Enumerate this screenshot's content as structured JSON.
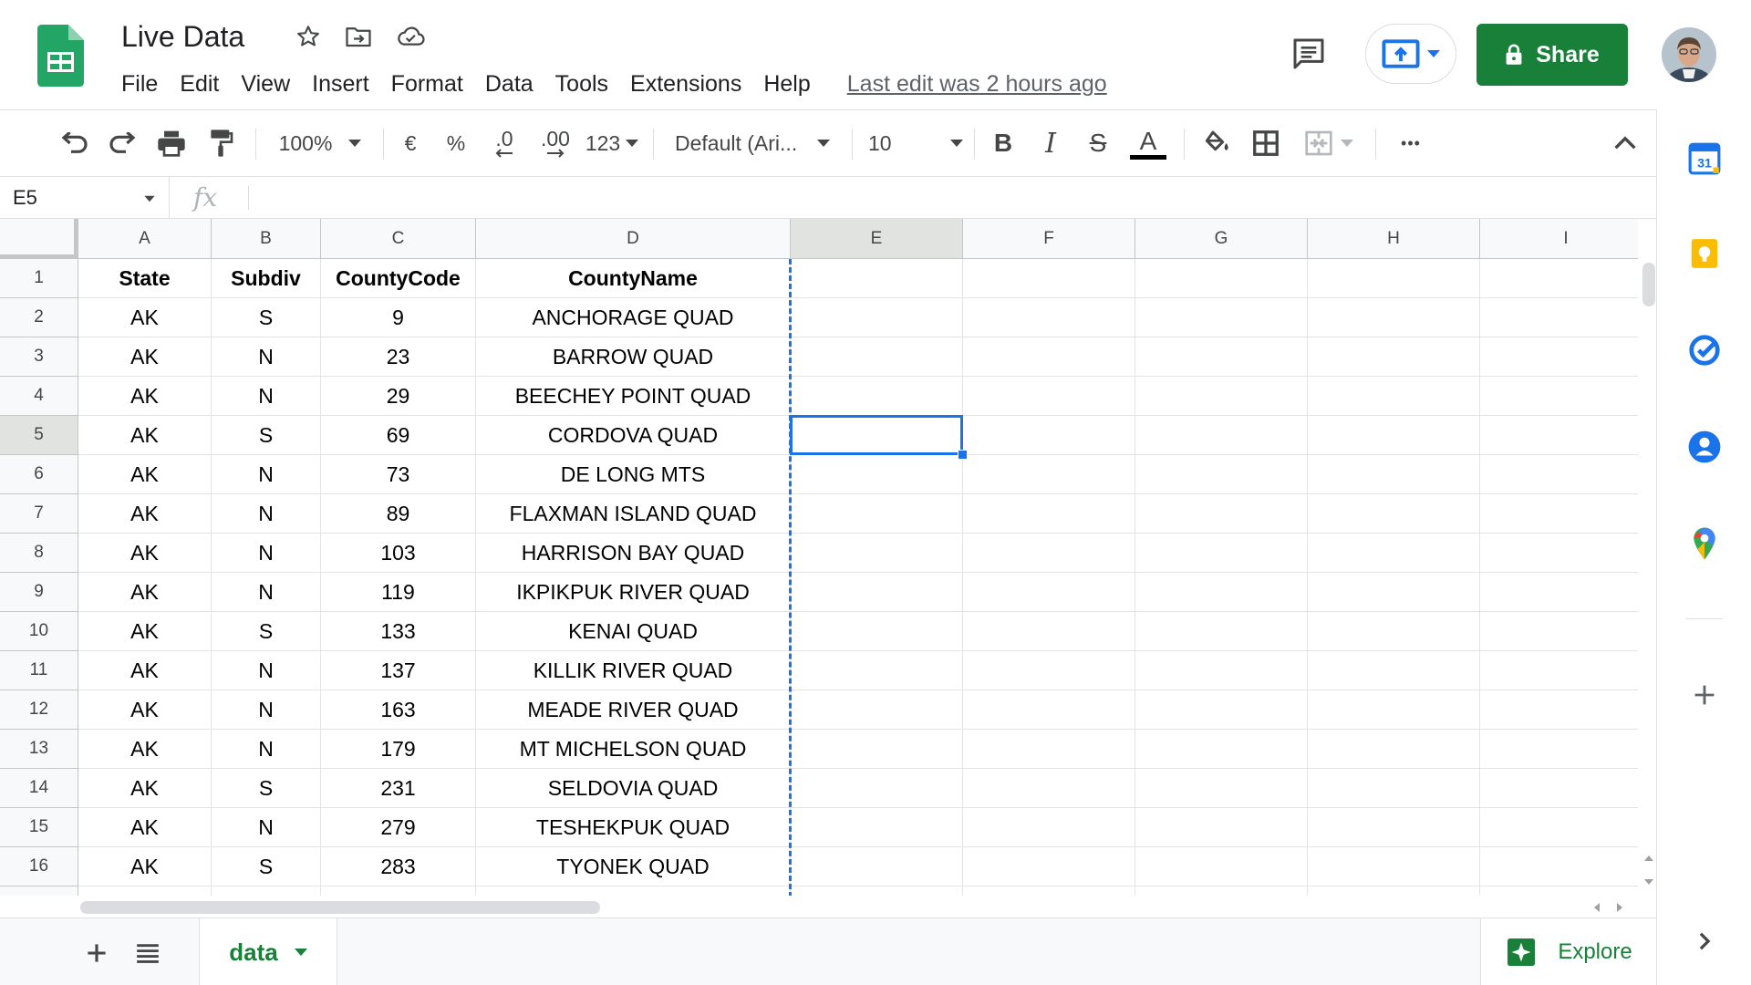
{
  "header": {
    "title": "Live Data",
    "menu": [
      "File",
      "Edit",
      "View",
      "Insert",
      "Format",
      "Data",
      "Tools",
      "Extensions",
      "Help"
    ],
    "last_edit": "Last edit was 2 hours ago",
    "share_label": "Share"
  },
  "toolbar": {
    "zoom": "100%",
    "currency": "€",
    "percent": "%",
    "decrease_decimal": ".0",
    "increase_decimal": ".00",
    "number_format": "123",
    "font": "Default (Ari...",
    "font_size": "10",
    "bold": "B",
    "italic": "I",
    "strike": "S",
    "text_color": "A",
    "more": "•••"
  },
  "formula_bar": {
    "cell_ref": "E5",
    "fx": "fx",
    "value": ""
  },
  "columns": [
    "A",
    "B",
    "C",
    "D",
    "E",
    "F",
    "G",
    "H",
    "I"
  ],
  "selected_cell": "E5",
  "sheet": {
    "header": [
      "State",
      "Subdiv",
      "CountyCode",
      "CountyName"
    ],
    "rows": [
      [
        "AK",
        "S",
        "9",
        "ANCHORAGE QUAD"
      ],
      [
        "AK",
        "N",
        "23",
        "BARROW QUAD"
      ],
      [
        "AK",
        "N",
        "29",
        "BEECHEY POINT QUAD"
      ],
      [
        "AK",
        "S",
        "69",
        "CORDOVA QUAD"
      ],
      [
        "AK",
        "N",
        "73",
        "DE LONG MTS"
      ],
      [
        "AK",
        "N",
        "89",
        "FLAXMAN ISLAND QUAD"
      ],
      [
        "AK",
        "N",
        "103",
        "HARRISON BAY QUAD"
      ],
      [
        "AK",
        "N",
        "119",
        "IKPIKPUK RIVER QUAD"
      ],
      [
        "AK",
        "S",
        "133",
        "KENAI QUAD"
      ],
      [
        "AK",
        "N",
        "137",
        "KILLIK RIVER QUAD"
      ],
      [
        "AK",
        "N",
        "163",
        "MEADE RIVER QUAD"
      ],
      [
        "AK",
        "N",
        "179",
        "MT MICHELSON QUAD"
      ],
      [
        "AK",
        "S",
        "231",
        "SELDOVIA QUAD"
      ],
      [
        "AK",
        "N",
        "279",
        "TESHEKPUK QUAD"
      ],
      [
        "AK",
        "S",
        "283",
        "TYONEK QUAD"
      ]
    ]
  },
  "tabs": {
    "sheet_name": "data",
    "explore_label": "Explore"
  },
  "colors": {
    "brand_green": "#188038",
    "selection_blue": "#1a73e8"
  }
}
